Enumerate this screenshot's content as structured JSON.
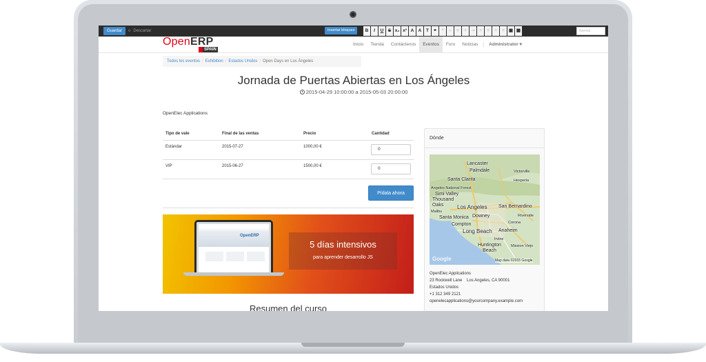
{
  "editor": {
    "save_label": "Guardar",
    "or_label": "o",
    "discard_label": "Descartar",
    "insert_blocks_label": "Insertar bloques",
    "format_buttons": [
      "B",
      "I",
      "U",
      "S",
      "x₂",
      "x²",
      "A",
      "A",
      "T"
    ],
    "style_placeholder": "Normal"
  },
  "header": {
    "logo_open": "Open",
    "logo_erp": "ERP",
    "logo_spain": "SPAIN",
    "nav": [
      "Inicio",
      "Tienda",
      "Contáctenos",
      "Eventos",
      "Foro",
      "Noticias"
    ],
    "active_nav": "Eventos",
    "user": "Administrator ▾"
  },
  "breadcrumb": {
    "links": [
      "Todos los eventos",
      "Exhibition",
      "Estados Unidos"
    ],
    "current": "Open Days en Los Ángeles"
  },
  "event": {
    "title": "Jornada de Puertas Abiertas en Los Ángeles",
    "dates": "2015-04-29 10:00:00 a 2015-05-03 20:00:00",
    "organizer": "OpenElec Applications"
  },
  "tickets": {
    "headers": [
      "Tipo de vale",
      "Final de las ventas",
      "Precio",
      "Cantidad"
    ],
    "rows": [
      {
        "type": "Estándar",
        "end": "2015-07-27",
        "price": "1000,00 €",
        "qty": "0"
      },
      {
        "type": "VIP",
        "end": "2015-06-27",
        "price": "1500,00 €",
        "qty": "0"
      }
    ],
    "order_label": "Pídala ahora"
  },
  "banner": {
    "heading": "5 días intensivos",
    "subheading": "para aprender desarrollo JS",
    "mini_brand": "OpenERP"
  },
  "course": {
    "title": "Resumen del curso"
  },
  "where": {
    "heading": "Dónde",
    "map_labels": {
      "lancaster": "Lancaster",
      "palmdale": "Palmdale",
      "victorville": "Victorville",
      "santa_clarita": "Santa Clarita",
      "hesperia": "Hesperia",
      "forest": "Angeles National Forest",
      "simi": "Simi Valley",
      "thousand_oaks": "Thousand Oaks",
      "malibu": "Malibu",
      "los_angeles": "Los Angeles",
      "san_bernardino": "San Bernardino",
      "santa_monica": "Santa Monica",
      "downey": "Downey",
      "compton": "Compton",
      "riverside": "Riverside",
      "corona": "Corona",
      "long_beach": "Long Beach",
      "anaheim": "Anaheim",
      "irvine": "Irvine",
      "huntington": "Huntington Beach",
      "mission_viejo": "Mission Viejo",
      "google": "Google",
      "copyright": "Map data ©2015 Google"
    },
    "address_lines": [
      "OpenElec Applications",
      "23 Rockwell Lane    Los Angeles, CA 90001",
      "Estados Unidos",
      "+1 312 349 2121",
      "openelecapplications@yourcompany.example.com"
    ]
  }
}
